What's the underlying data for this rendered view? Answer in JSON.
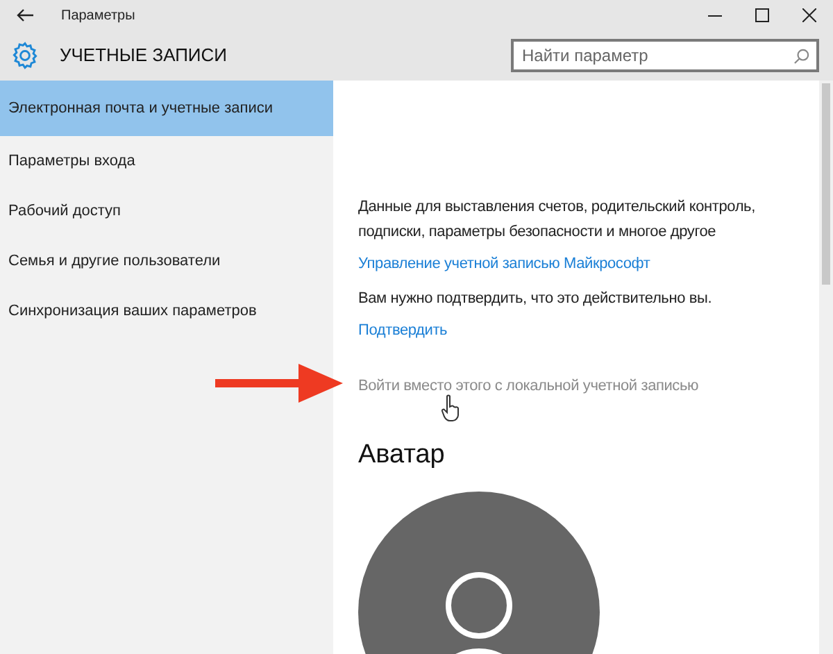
{
  "window": {
    "title": "Параметры"
  },
  "header": {
    "title": "УЧЕТНЫЕ ЗАПИСИ",
    "search": {
      "placeholder": "Найти параметр"
    }
  },
  "sidebar": {
    "items": [
      {
        "label": "Электронная почта и учетные записи",
        "selected": true
      },
      {
        "label": "Параметры входа",
        "selected": false
      },
      {
        "label": "Рабочий доступ",
        "selected": false
      },
      {
        "label": "Семья и другие пользователи",
        "selected": false
      },
      {
        "label": "Синхронизация ваших параметров",
        "selected": false
      }
    ]
  },
  "content": {
    "items": [
      {
        "kind": "text",
        "text": "Данные для выставления счетов, родительский контроль, подписки, параметры безопасности и многое другое"
      },
      {
        "kind": "link",
        "text": "Управление учетной записью Майкрософт"
      },
      {
        "kind": "text",
        "text": "Вам нужно подтвердить, что это действительно вы."
      },
      {
        "kind": "link",
        "text": "Подтвердить"
      },
      {
        "kind": "muted-link",
        "text": "Войти вместо этого с локальной учетной записью"
      }
    ],
    "avatar_heading": "Аватар"
  }
}
